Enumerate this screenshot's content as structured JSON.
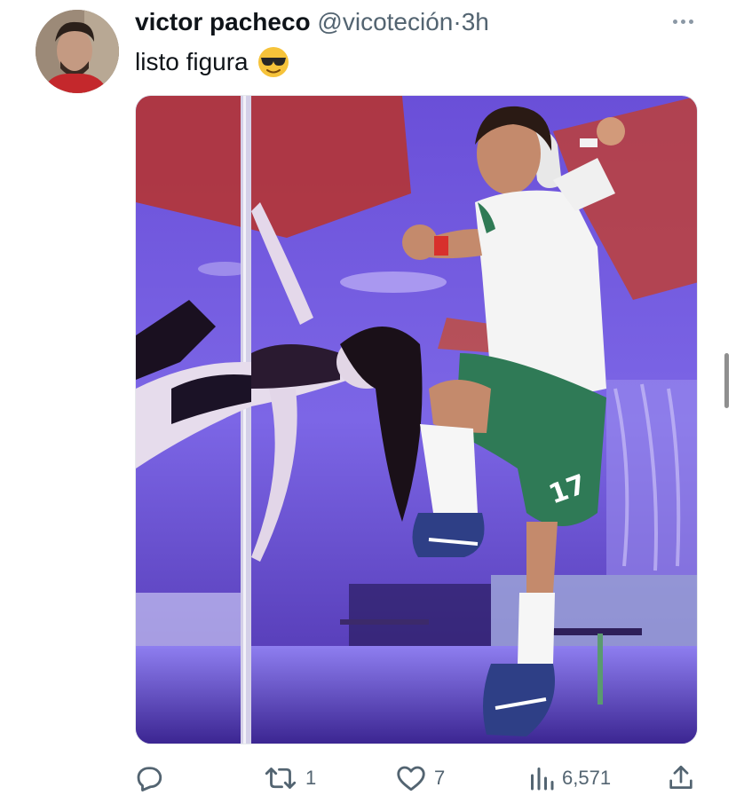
{
  "tweet": {
    "display_name": "victor pacheco",
    "handle": "@vicoteción",
    "separator": "·",
    "time": "3h",
    "text": "listo figura",
    "emoji": "sunglasses-face-emoji"
  },
  "actions": {
    "reply_count": "",
    "retweet_count": "1",
    "like_count": "7",
    "views_count": "6,571"
  },
  "colors": {
    "text_primary": "#0f1419",
    "text_secondary": "#536471",
    "media_purple": "#7a5ce0"
  }
}
